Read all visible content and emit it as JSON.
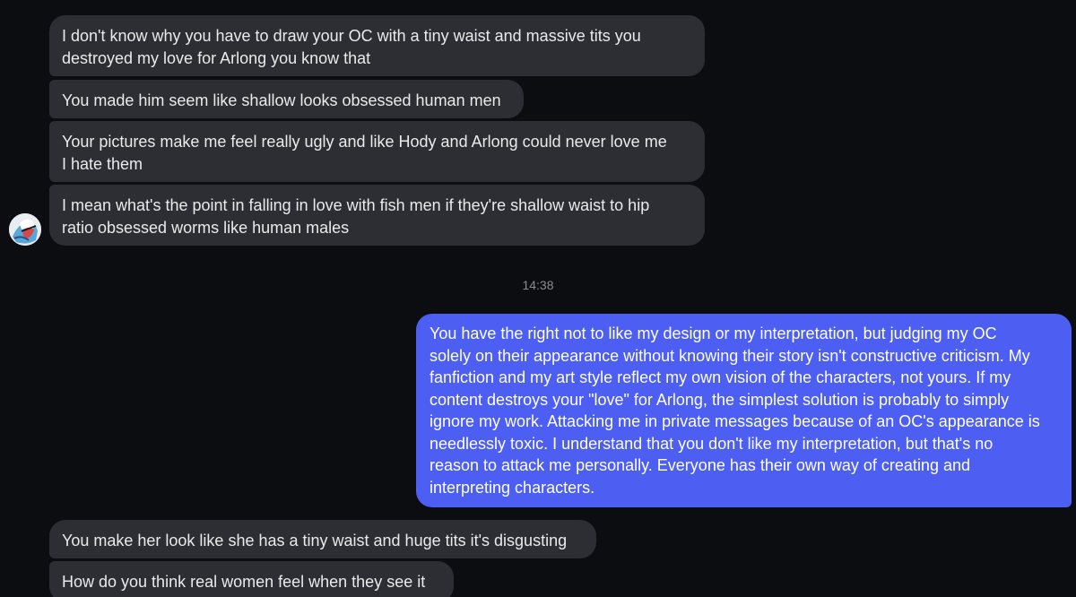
{
  "messages": [
    {
      "text": "I don't know why you have to draw your OC with a tiny waist and massive tits you\ndestroyed my love for Arlong you know that"
    },
    {
      "text": "You made him seem like shallow looks obsessed human men"
    },
    {
      "text": "Your pictures make me feel really ugly and like Hody and Arlong could never love me\nI hate them"
    },
    {
      "text": "I mean what's the point in falling in love with fish men if they're shallow waist to hip\nratio obsessed worms like human males"
    },
    {
      "text": "You have the right not to like my design or my interpretation, but judging my OC\nsolely on their appearance without knowing their story isn't constructive criticism. My\nfanfiction and my art style reflect my own vision of the characters, not yours. If my\ncontent destroys your \"love\" for Arlong, the simplest solution is probably to simply\nignore my work. Attacking me in private messages because of an OC's appearance is\nneedlessly toxic. I understand that you don't like my interpretation, but that's no\nreason to attack me personally. Everyone has their own way of creating and\ninterpreting characters."
    },
    {
      "text": "You make her look like she has a tiny waist and huge tits it's disgusting"
    },
    {
      "text": "How do you think real women feel when they see it"
    }
  ],
  "timestamp": "14:38",
  "colors": {
    "background": "#0c0d11",
    "incoming_bubble": "#2d2e33",
    "outgoing_bubble": "#4c5ff2"
  },
  "avatar_icon": "user-avatar-icon"
}
